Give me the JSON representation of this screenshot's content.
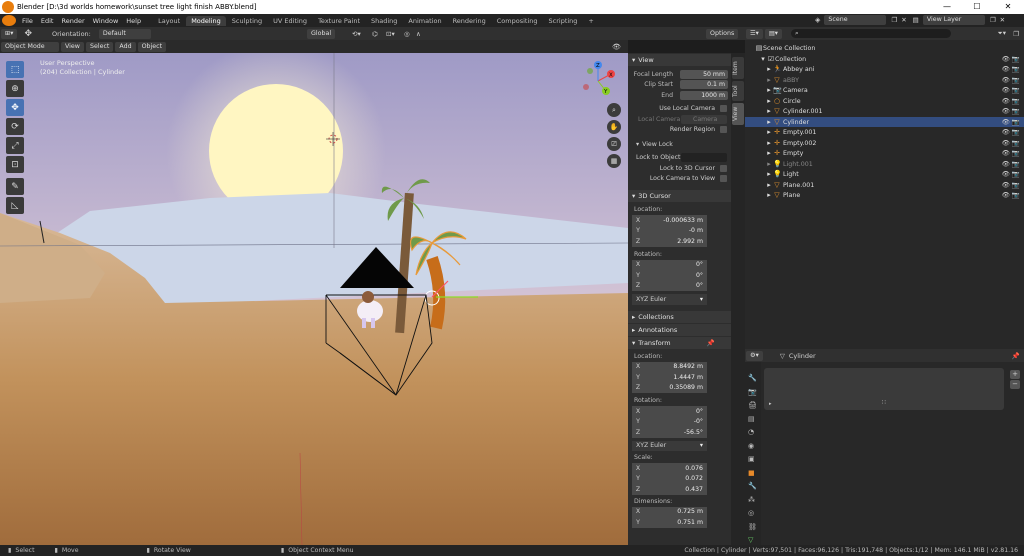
{
  "window": {
    "title": "Blender [D:\\3d worlds homework\\sunset tree light finish ABBY.blend]",
    "minimize": "—",
    "maximize": "☐",
    "close": "✕"
  },
  "menu": [
    "File",
    "Edit",
    "Render",
    "Window",
    "Help"
  ],
  "workspaces": [
    "Layout",
    "Modeling",
    "Sculpting",
    "UV Editing",
    "Texture Paint",
    "Shading",
    "Animation",
    "Rendering",
    "Compositing",
    "Scripting"
  ],
  "active_workspace": "Modeling",
  "add_workspace": "+",
  "scene": {
    "name": "Scene",
    "view_layer": "View Layer"
  },
  "tool_header": {
    "orientation_label": "Orientation:",
    "orientation_value": "Default",
    "transform_orientation": "Global",
    "options": "Options"
  },
  "viewport_header": {
    "mode": "Object Mode",
    "view": "View",
    "select": "Select",
    "add": "Add",
    "object": "Object"
  },
  "viewport": {
    "perspective": "User Perspective",
    "collection_info": "(204) Collection | Cylinder"
  },
  "gizmo": {
    "x": "X",
    "y": "Y",
    "z": "Z"
  },
  "npanel": {
    "tabs": [
      "Item",
      "Tool",
      "View"
    ],
    "active_tab": "View",
    "view": {
      "title": "View",
      "focal_length_label": "Focal Length",
      "focal_length": "50 mm",
      "clip_start_label": "Clip Start",
      "clip_start": "0.1 m",
      "end_label": "End",
      "end": "1000 m",
      "use_local_camera": "Use Local Camera",
      "local_camera_label": "Local Camera",
      "local_camera_value": "Camera",
      "render_region": "Render Region"
    },
    "view_lock": {
      "title": "View Lock",
      "lock_to_object": "Lock to Object",
      "lock_to_cursor": "Lock to 3D Cursor",
      "lock_camera": "Lock Camera to View"
    },
    "cursor": {
      "title": "3D Cursor",
      "location_label": "Location:",
      "x": "-0.000633 m",
      "y": "-0 m",
      "z": "2.992 m",
      "rotation_label": "Rotation:",
      "rx": "0°",
      "ry": "0°",
      "rz": "0°",
      "mode": "XYZ Euler"
    },
    "collections": "Collections",
    "annotations": "Annotations",
    "transform": {
      "title": "Transform",
      "location_label": "Location:",
      "x": "8.8492 m",
      "y": "1.4447 m",
      "z": "0.35089 m",
      "rotation_label": "Rotation:",
      "rx": "0°",
      "ry": "-0°",
      "rz": "-56.5°",
      "mode": "XYZ Euler",
      "scale_label": "Scale:",
      "sx": "0.076",
      "sy": "0.072",
      "sz": "0.437",
      "dimensions_label": "Dimensions:",
      "dx": "0.725 m",
      "dy": "0.751 m"
    }
  },
  "outliner": {
    "root": "Scene Collection",
    "collection": "Collection",
    "items": [
      {
        "name": "Abbey ani",
        "dim": false
      },
      {
        "name": "aBBY",
        "dim": true
      },
      {
        "name": "Camera",
        "dim": false
      },
      {
        "name": "Circle",
        "dim": false
      },
      {
        "name": "Cylinder.001",
        "dim": false
      },
      {
        "name": "Cylinder",
        "dim": false
      },
      {
        "name": "Empty.001",
        "dim": false
      },
      {
        "name": "Empty.002",
        "dim": false
      },
      {
        "name": "Empty",
        "dim": false
      },
      {
        "name": "Light.001",
        "dim": true
      },
      {
        "name": "Light",
        "dim": false
      },
      {
        "name": "Plane.001",
        "dim": false
      },
      {
        "name": "Plane",
        "dim": false
      }
    ],
    "selected": "Cylinder"
  },
  "properties": {
    "object_name": "Cylinder"
  },
  "statusbar": {
    "select": "Select",
    "move": "Move",
    "rotate": "Rotate View",
    "context": "Object Context Menu",
    "stats": "Collection | Cylinder | Verts:97,501 | Faces:96,126 | Tris:191,748 | Objects:1/12 | Mem: 146.1 MiB | v2.81.16"
  },
  "colors": {
    "accent": "#4772b3",
    "selected_row": "#334d80",
    "sky_top": "#a9a2c9",
    "sand": "#b98a58",
    "sun": "#fff7c4"
  }
}
